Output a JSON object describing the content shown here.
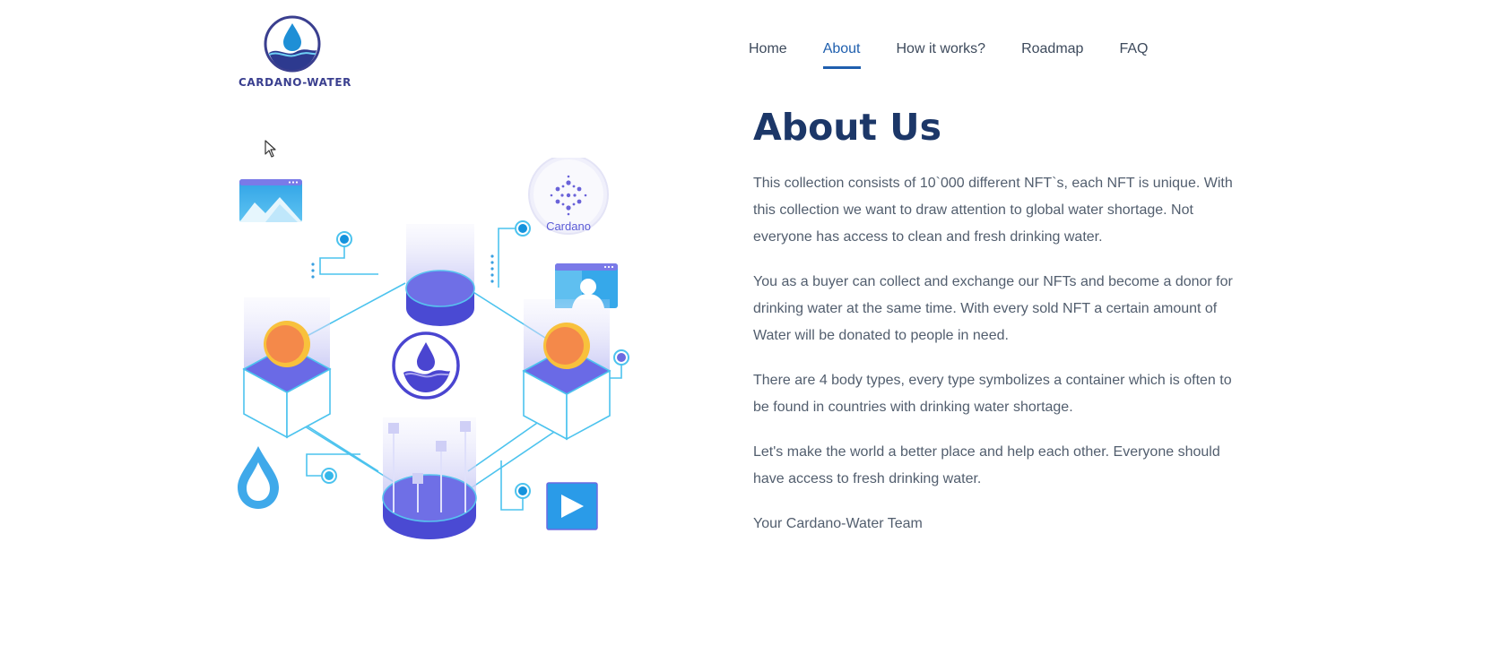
{
  "brand": {
    "name": "CARDANO-WATER",
    "logo_icon": "water-drop-wave-logo"
  },
  "nav": {
    "items": [
      {
        "label": "Home",
        "active": false
      },
      {
        "label": "About",
        "active": true
      },
      {
        "label": "How it works?",
        "active": false
      },
      {
        "label": "Roadmap",
        "active": false
      },
      {
        "label": "FAQ",
        "active": false
      }
    ]
  },
  "about": {
    "title": "About Us",
    "paragraphs": [
      "This collection consists of 10`000 different NFT`s, each NFT is unique. With this collection we want to draw attention to global water shortage. Not everyone has access to clean and fresh drinking water.",
      "You as a buyer can collect and exchange our NFTs and become a donor for drinking water at the same time. With every sold NFT a certain amount of Water will be donated to people in need.",
      "There are 4 body types, every type symbolizes a container which is often to be found in countries with drinking water shortage.",
      "Let's make the world a better place and help each other. Everyone should have access to fresh drinking water.",
      "Your Cardano-Water Team"
    ]
  },
  "illustration": {
    "cardano_label": "Cardano"
  },
  "colors": {
    "accent": "#1f5fae",
    "title": "#1c3768",
    "purple": "#6b6be0",
    "cyan": "#4cc3ee",
    "orange": "#f4894a"
  }
}
